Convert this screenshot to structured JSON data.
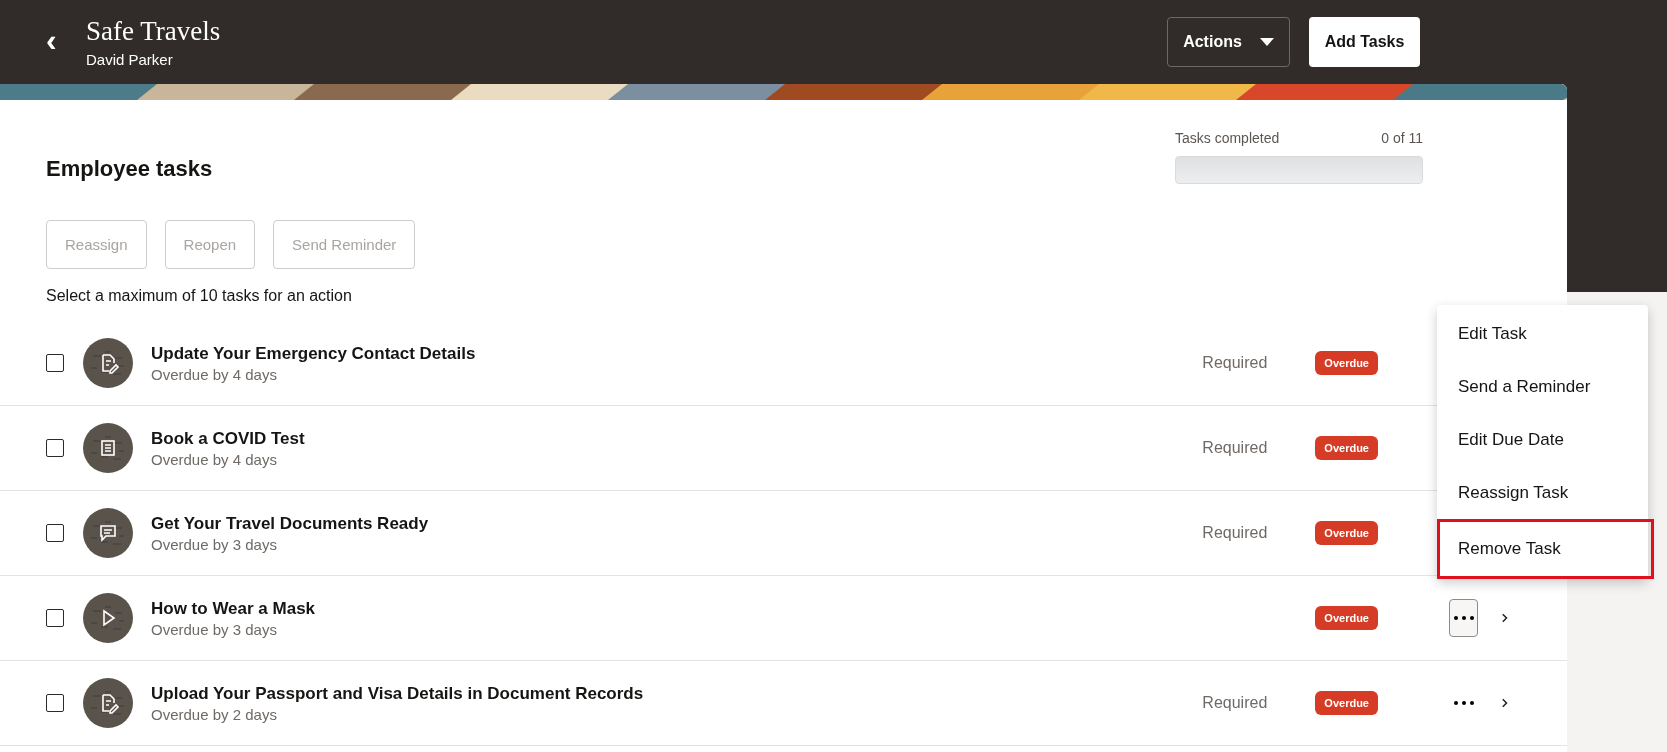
{
  "header": {
    "back_icon": "‹",
    "title": "Safe Travels",
    "subtitle": "David Parker",
    "actions_button": "Actions",
    "add_button": "Add Tasks"
  },
  "section": {
    "title": "Employee tasks",
    "progress": {
      "label": "Tasks completed",
      "reading": "0 of 11",
      "level": 0
    }
  },
  "bulk_actions": [
    {
      "label": "Reassign",
      "disabled": true
    },
    {
      "label": "Reopen",
      "disabled": true
    },
    {
      "label": "Send Reminder",
      "disabled": true
    }
  ],
  "hint": "Select a maximum of 10 tasks for an action",
  "tasks": [
    {
      "kind": "form",
      "title": "Update Your Emergency Contact Details",
      "due": "Overdue by 4 days",
      "requirement": "Required",
      "status": "Overdue",
      "checked": false,
      "menu_open": false,
      "show_more": false
    },
    {
      "kind": "document",
      "title": "Book a COVID Test",
      "due": "Overdue by 4 days",
      "requirement": "Required",
      "status": "Overdue",
      "checked": false,
      "menu_open": false,
      "show_more": false
    },
    {
      "kind": "chat",
      "title": "Get Your Travel Documents Ready",
      "due": "Overdue by 3 days",
      "requirement": "Required",
      "status": "Overdue",
      "checked": false,
      "menu_open": false,
      "show_more": false
    },
    {
      "kind": "video",
      "title": "How to Wear a Mask",
      "due": "Overdue by 3 days",
      "status": "Overdue",
      "checked": false,
      "menu_open": true,
      "show_more": true
    },
    {
      "kind": "form",
      "title": "Upload Your Passport and Visa Details in Document Records",
      "due": "Overdue by 2 days",
      "requirement": "Required",
      "status": "Overdue",
      "checked": false,
      "menu_open": false,
      "show_more": true
    }
  ],
  "menu": [
    {
      "label": "Edit Task",
      "highlighted": false
    },
    {
      "label": "Send a Reminder",
      "highlighted": false
    },
    {
      "label": "Edit Due Date",
      "highlighted": false
    },
    {
      "label": "Reassign Task",
      "highlighted": false
    },
    {
      "label": "Remove Task",
      "highlighted": true
    }
  ]
}
